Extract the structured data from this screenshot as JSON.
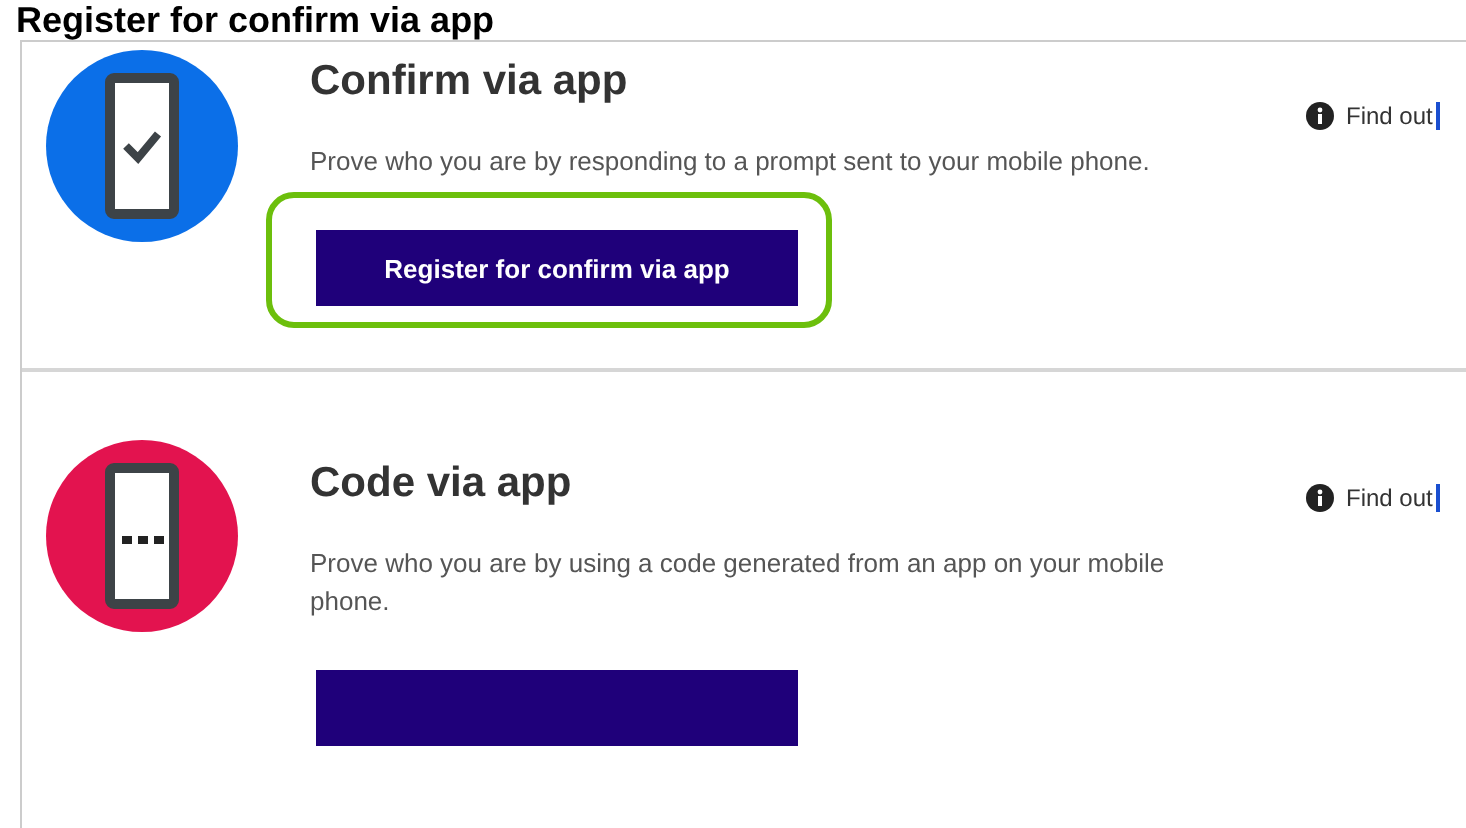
{
  "heading": "Register for confirm via app",
  "options": [
    {
      "kind": "confirm",
      "color": "#0b6fe8",
      "title": "Confirm via app",
      "description": "Prove who you are by responding to a prompt sent to your mobile phone.",
      "info_link": "Find out",
      "button_label": "Register for confirm via app",
      "highlighted": true
    },
    {
      "kind": "code",
      "color": "#e3134f",
      "title": "Code via app",
      "description": "Prove who you are by using a code generated from an app on your mobile phone.",
      "info_link": "Find out",
      "highlighted": false
    }
  ]
}
